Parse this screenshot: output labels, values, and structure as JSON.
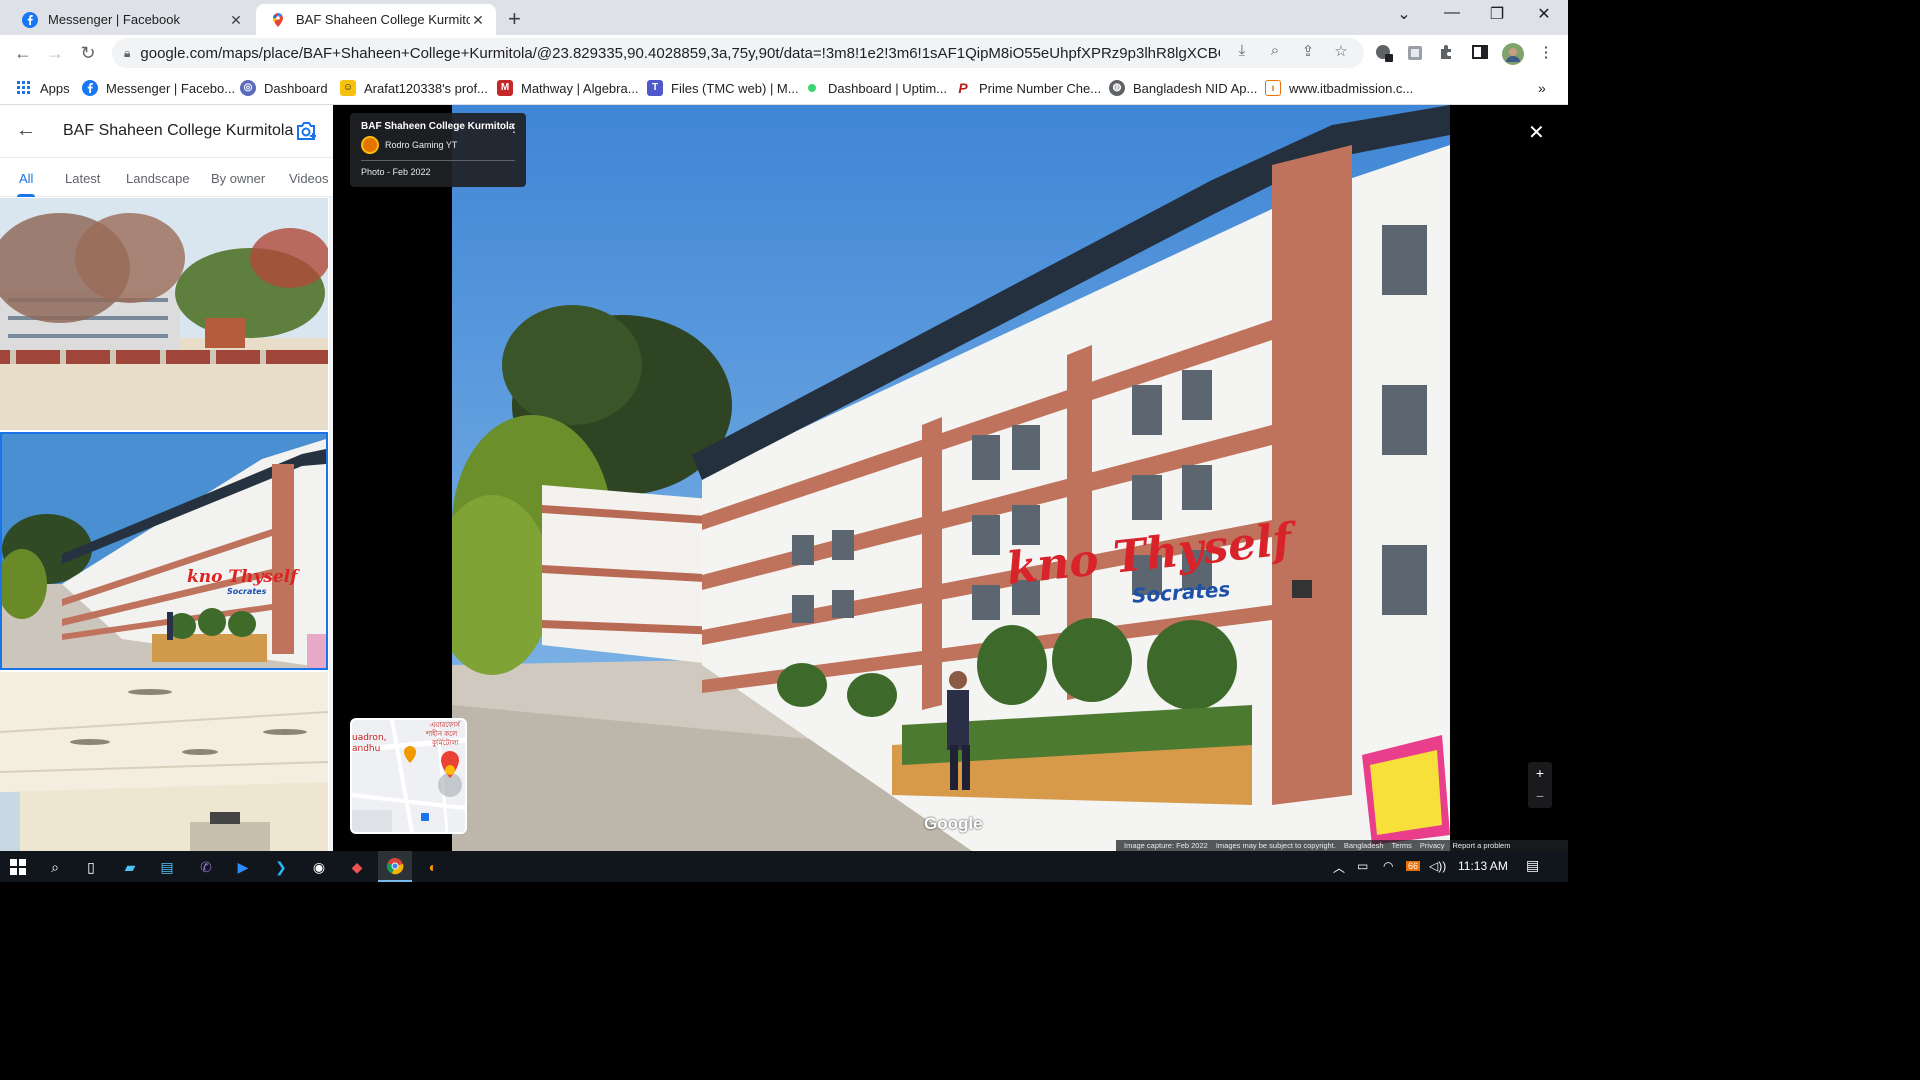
{
  "browser": {
    "tabs": [
      {
        "title": "Messenger | Facebook",
        "icon": "facebook-icon",
        "active": false
      },
      {
        "title": "BAF Shaheen College Kurmitola -",
        "icon": "google-maps-icon",
        "active": true
      }
    ],
    "url": "google.com/maps/place/BAF+Shaheen+College+Kurmitola/@23.829335,90.4028859,3a,75y,90t/data=!3m8!1e2!3m6!1sAF1QipM8iO55eUhpfXPRz9p3lhR8lgXCBO7BkqFu...",
    "bookmarks": [
      {
        "label": "Apps",
        "icon": "apps-grid-icon"
      },
      {
        "label": "Messenger | Facebo...",
        "icon": "facebook-icon"
      },
      {
        "label": "Dashboard",
        "icon": "dashboard-site-icon"
      },
      {
        "label": "Arafat120338's prof...",
        "icon": "profile-site-icon"
      },
      {
        "label": "Mathway | Algebra...",
        "icon": "mathway-icon"
      },
      {
        "label": "Files (TMC web) | M...",
        "icon": "teams-icon"
      },
      {
        "label": "Dashboard | Uptim...",
        "icon": "uptime-icon"
      },
      {
        "label": "Prime Number Che...",
        "icon": "prime-number-icon"
      },
      {
        "label": "Bangladesh NID Ap...",
        "icon": "globe-icon"
      },
      {
        "label": "www.itbadmission.c...",
        "icon": "itbadmission-icon"
      }
    ]
  },
  "maps": {
    "place_title": "BAF Shaheen College Kurmitola",
    "photo_tabs": [
      "All",
      "Latest",
      "Landscape",
      "By owner",
      "Videos"
    ],
    "selected_tab": "All",
    "info_card": {
      "title": "BAF Shaheen College Kurmitola",
      "author": "Rodro Gaming YT",
      "date": "Photo - Feb 2022"
    },
    "minimap_labels": {
      "left": "uadron,\nandhu",
      "right": "এয়ারফোর্স\nশাহীন কলে\nকুর্মিটোলা"
    },
    "google_logo": "Google",
    "attribution": [
      "Image capture: Feb 2022",
      "Images may be subject to copyright.",
      "Bangladesh",
      "Terms",
      "Privacy",
      "Report a problem"
    ],
    "photo_wall_text": {
      "line1": "kno  Thyself",
      "line2": "Socrates"
    }
  },
  "taskbar": {
    "apps": [
      "windows-start-icon",
      "search-icon",
      "task-view-icon",
      "taskbar-app-icon",
      "taskbar-app-icon",
      "viber-icon",
      "zoom-icon",
      "vscode-icon",
      "obs-icon",
      "game-app-icon",
      "chrome-icon",
      "blender-icon"
    ],
    "battery_badge": "66",
    "time": "11:13 AM"
  },
  "colors": {
    "accent": "#1a73e8",
    "chrome_frame": "#dee1e6",
    "taskbar": "#10161c",
    "building_orange": "#c8705a"
  }
}
